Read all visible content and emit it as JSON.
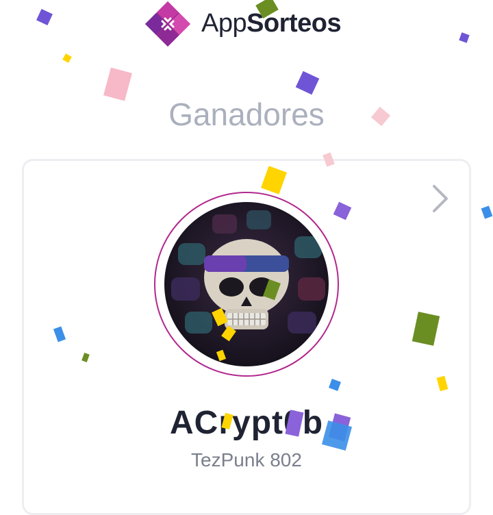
{
  "brand": {
    "prefix": "App",
    "suffix": "Sorteos"
  },
  "section_title": "Ganadores",
  "winner": {
    "name": "ACrypt0b",
    "subtitle": "TezPunk 802"
  },
  "colors": {
    "brand_magenta": "#b2278d",
    "brand_purple": "#6a3fb0",
    "title_gray": "#aab0bd",
    "text_dark": "#1f2333",
    "confetti": [
      "#6f55d6",
      "#f7c9d0",
      "#ffd400",
      "#6b8e23",
      "#3b8fe8",
      "#8a62d9"
    ]
  },
  "icons": {
    "logo": "appsorteos-logo-icon",
    "next": "chevron-right-icon"
  }
}
